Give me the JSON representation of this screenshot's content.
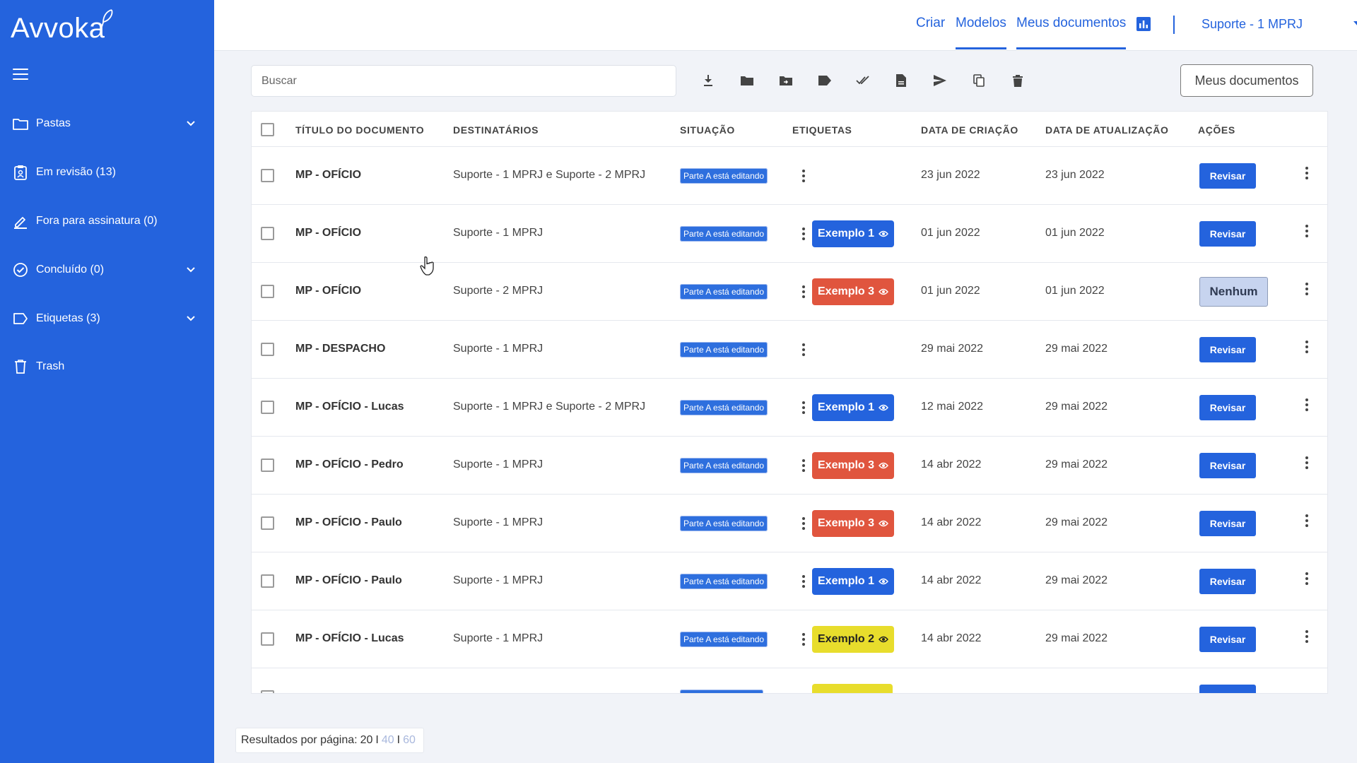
{
  "app": {
    "logo": "Avvoka"
  },
  "sidebar": {
    "items": [
      {
        "label": "Pastas",
        "icon": "folder-icon",
        "has_chevron": true
      },
      {
        "label": "Em revisão (13)",
        "icon": "review-icon",
        "has_chevron": false
      },
      {
        "label": "Fora para assinatura (0)",
        "icon": "pen-icon",
        "has_chevron": false
      },
      {
        "label": "Concluído (0)",
        "icon": "check-circle-icon",
        "has_chevron": true
      },
      {
        "label": "Etiquetas (3)",
        "icon": "tag-icon",
        "has_chevron": true
      },
      {
        "label": "Trash",
        "icon": "trash-icon",
        "has_chevron": false
      }
    ]
  },
  "topnav": {
    "links": [
      "Criar",
      "Modelos",
      "Meus documentos"
    ],
    "active": "Meus documentos",
    "user": "Suporte - 1 MPRJ"
  },
  "toolbar": {
    "search_placeholder": "Buscar",
    "icons": [
      "download-icon",
      "folder-icon",
      "move-folder-icon",
      "label-icon",
      "done-all-icon",
      "document-icon",
      "send-icon",
      "copy-icon",
      "delete-icon"
    ],
    "my_docs_button": "Meus documentos"
  },
  "table": {
    "headers": [
      "TÍTULO DO DOCUMENTO",
      "DESTINATÁRIOS",
      "SITUAÇÃO",
      "ETIQUETAS",
      "DATA DE CRIAÇÃO",
      "DATA DE ATUALIZAÇÃO",
      "AÇÕES"
    ],
    "rows": [
      {
        "title": "MP - OFÍCIO",
        "recipients": "Suporte - 1 MPRJ e Suporte - 2 MPRJ",
        "status": "Parte A está editando",
        "tag": "",
        "tag_color": "",
        "created": "23 jun 2022",
        "updated": "23 jun 2022",
        "action": "Revisar"
      },
      {
        "title": "MP - OFÍCIO",
        "recipients": "Suporte - 1 MPRJ",
        "status": "Parte A está editando",
        "tag": "Exemplo 1",
        "tag_color": "blue",
        "created": "01 jun 2022",
        "updated": "01 jun 2022",
        "action": "Revisar"
      },
      {
        "title": "MP - OFÍCIO",
        "recipients": "Suporte - 2 MPRJ",
        "status": "Parte A está editando",
        "tag": "Exemplo 3",
        "tag_color": "red",
        "created": "01 jun 2022",
        "updated": "01 jun 2022",
        "action": "Nenhum"
      },
      {
        "title": "MP - DESPACHO",
        "recipients": "Suporte - 1 MPRJ",
        "status": "Parte A está editando",
        "tag": "",
        "tag_color": "",
        "created": "29 mai 2022",
        "updated": "29 mai 2022",
        "action": "Revisar"
      },
      {
        "title": "MP - OFÍCIO - Lucas",
        "recipients": "Suporte - 1 MPRJ e Suporte - 2 MPRJ",
        "status": "Parte A está editando",
        "tag": "Exemplo 1",
        "tag_color": "blue",
        "created": "12 mai 2022",
        "updated": "29 mai 2022",
        "action": "Revisar"
      },
      {
        "title": "MP - OFÍCIO - Pedro",
        "recipients": "Suporte - 1 MPRJ",
        "status": "Parte A está editando",
        "tag": "Exemplo 3",
        "tag_color": "red",
        "created": "14 abr 2022",
        "updated": "29 mai 2022",
        "action": "Revisar"
      },
      {
        "title": "MP - OFÍCIO - Paulo",
        "recipients": "Suporte - 1 MPRJ",
        "status": "Parte A está editando",
        "tag": "Exemplo 3",
        "tag_color": "red",
        "created": "14 abr 2022",
        "updated": "29 mai 2022",
        "action": "Revisar"
      },
      {
        "title": "MP - OFÍCIO - Paulo",
        "recipients": "Suporte - 1 MPRJ",
        "status": "Parte A está editando",
        "tag": "Exemplo 1",
        "tag_color": "blue",
        "created": "14 abr 2022",
        "updated": "29 mai 2022",
        "action": "Revisar"
      },
      {
        "title": "MP - OFÍCIO - Lucas",
        "recipients": "Suporte - 1 MPRJ",
        "status": "Parte A está editando",
        "tag": "Exemplo 2",
        "tag_color": "yellow",
        "created": "14 abr 2022",
        "updated": "29 mai 2022",
        "action": "Revisar"
      }
    ]
  },
  "pagination": {
    "label": "Resultados por página:",
    "options": [
      "20",
      "40",
      "60"
    ],
    "active": "20",
    "sep": "I"
  },
  "colors": {
    "primary": "#2463dd",
    "tag_blue": "#2463dd",
    "tag_red": "#e0553e",
    "tag_yellow": "#e8dd2c",
    "status_badge": "#2e6fde"
  }
}
